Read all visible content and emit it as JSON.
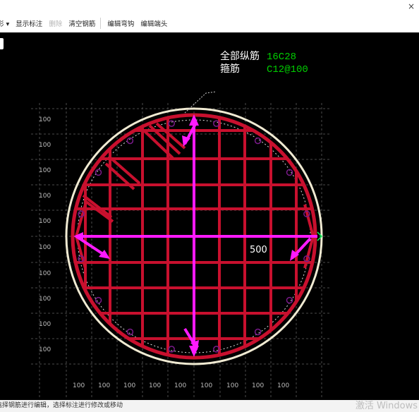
{
  "window": {
    "close_glyph": "×"
  },
  "toolbar": {
    "items": [
      {
        "label": "彩 ▾",
        "enabled": true
      },
      {
        "label": "显示标注",
        "enabled": true
      },
      {
        "label": "删除",
        "enabled": false
      },
      {
        "label": "清空钢筋",
        "enabled": true
      },
      {
        "label": "编辑弯钩",
        "enabled": true
      },
      {
        "label": "编辑端头",
        "enabled": true
      }
    ]
  },
  "section": {
    "longitudinal_label": "全部纵筋",
    "longitudinal_value": "16C28",
    "stirrup_label": "箍筋",
    "stirrup_value": "C12@100",
    "diameter_label": "500",
    "grid_label": "100",
    "colors": {
      "background": "#000000",
      "grid": "#4a4a4a",
      "outline": "#f0ead2",
      "rebar": "#c8102e",
      "dimension": "#ff1aff",
      "bar_point": "#7a1a8a",
      "value_text": "#00d000",
      "label_text": "#ffffff",
      "extent": "#00ff55"
    }
  },
  "status": {
    "hint": "选择钢筋进行编辑，选择标注进行修改或移动",
    "watermark": "激活 Windows"
  }
}
